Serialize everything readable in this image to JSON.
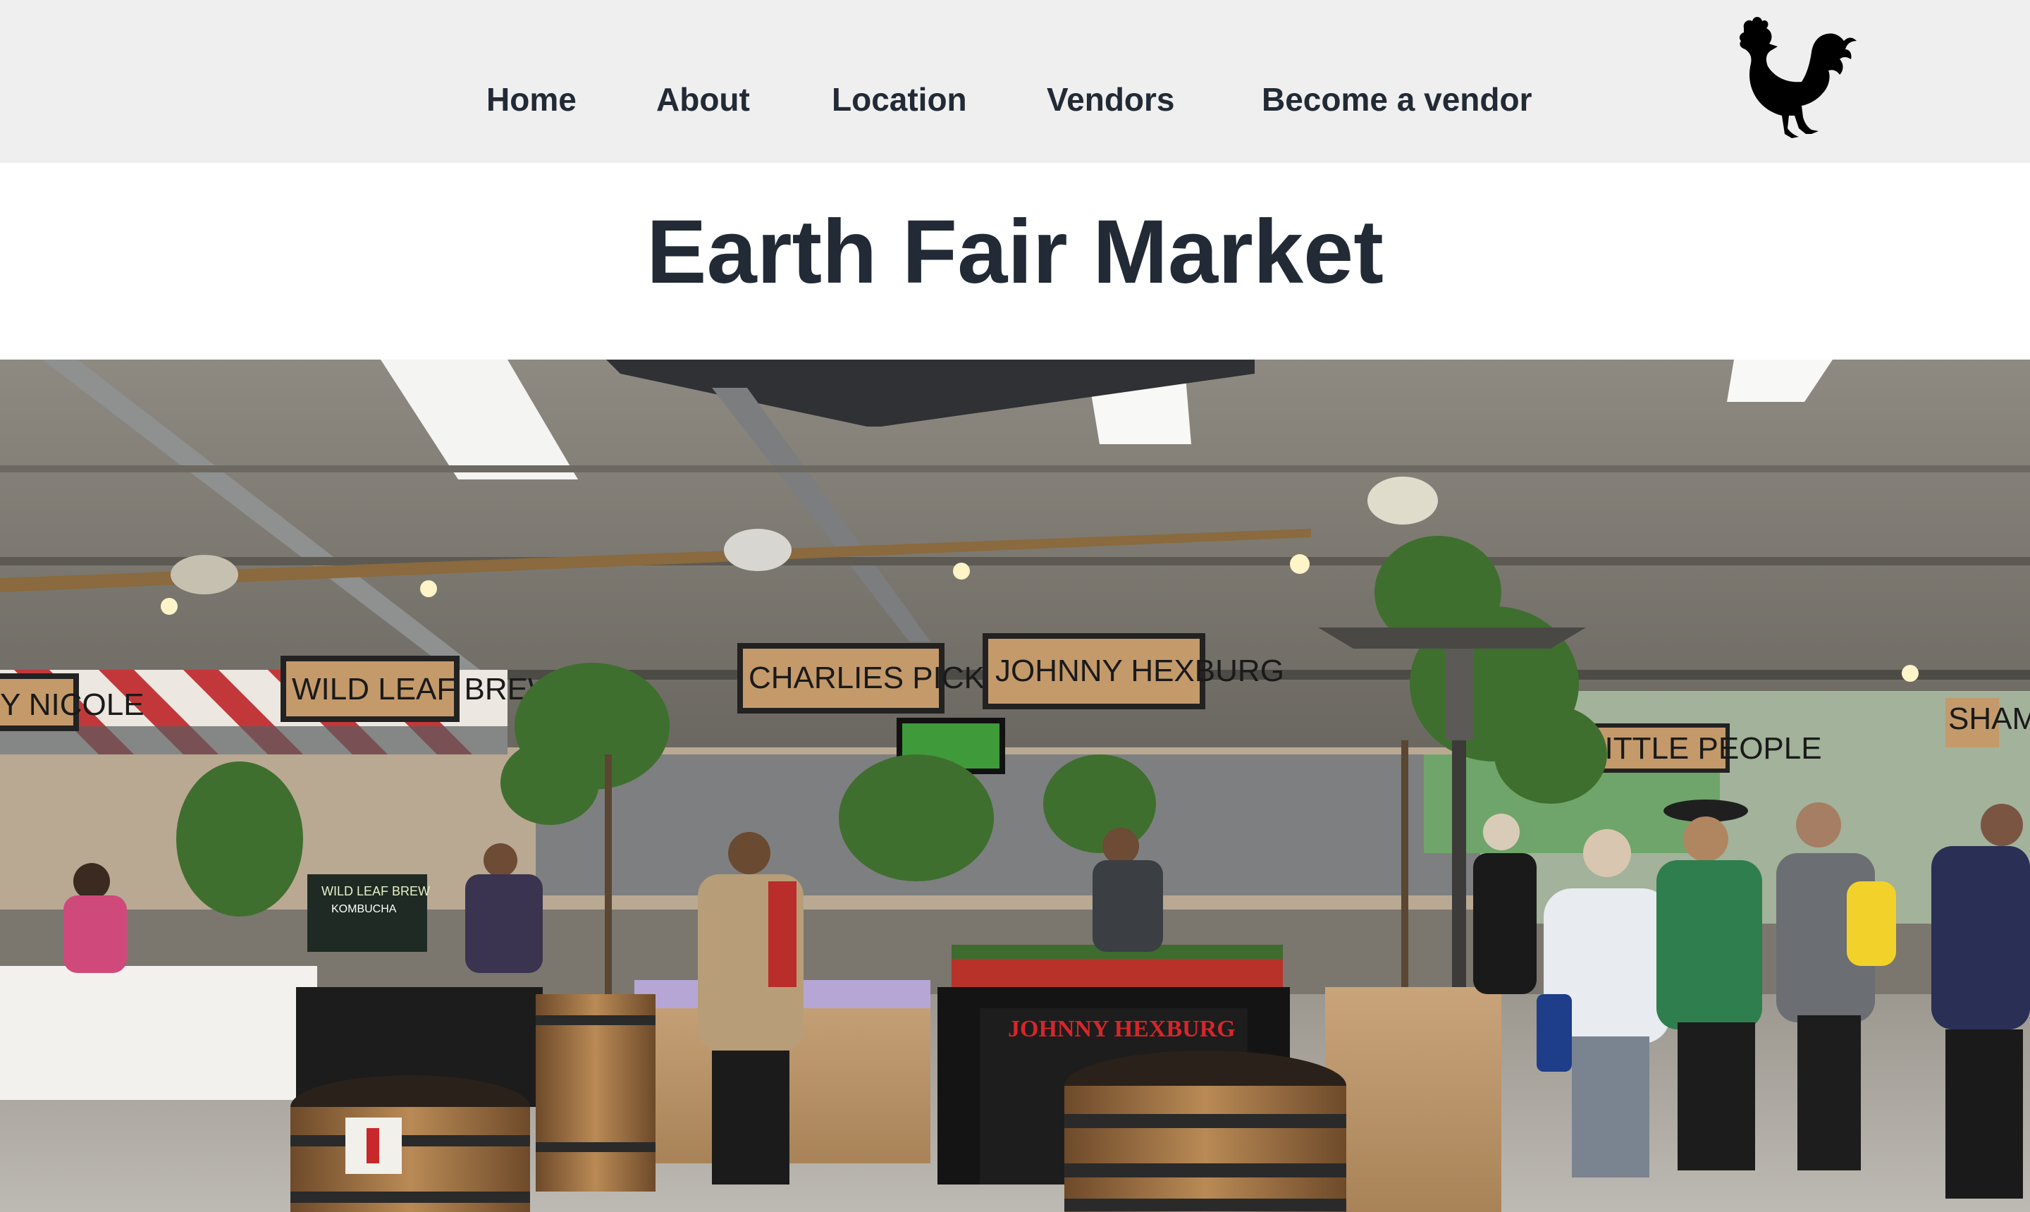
{
  "nav": {
    "items": [
      {
        "label": "Home"
      },
      {
        "label": "About"
      },
      {
        "label": "Location"
      },
      {
        "label": "Vendors"
      },
      {
        "label": "Become a vendor"
      }
    ]
  },
  "logo": {
    "icon": "rooster-icon"
  },
  "page": {
    "title": "Earth Fair Market"
  },
  "hero": {
    "signs": {
      "nicole": "Y NICOLE",
      "wild_leaf": "WILD LEAF BREW",
      "charlies": "CHARLIES PICKLES",
      "johnny": "JOHNNY HEXBURG",
      "little_people": "LITTLE PEOPLE",
      "shamies": "SHAMIES",
      "johnny_stall": "JOHNNY HEXBURG",
      "chalkboard_title": "WILD LEAF BREW",
      "chalkboard_sub": "KOMBUCHA"
    }
  },
  "colors": {
    "nav_bg": "#efefef",
    "text": "#222a36"
  }
}
